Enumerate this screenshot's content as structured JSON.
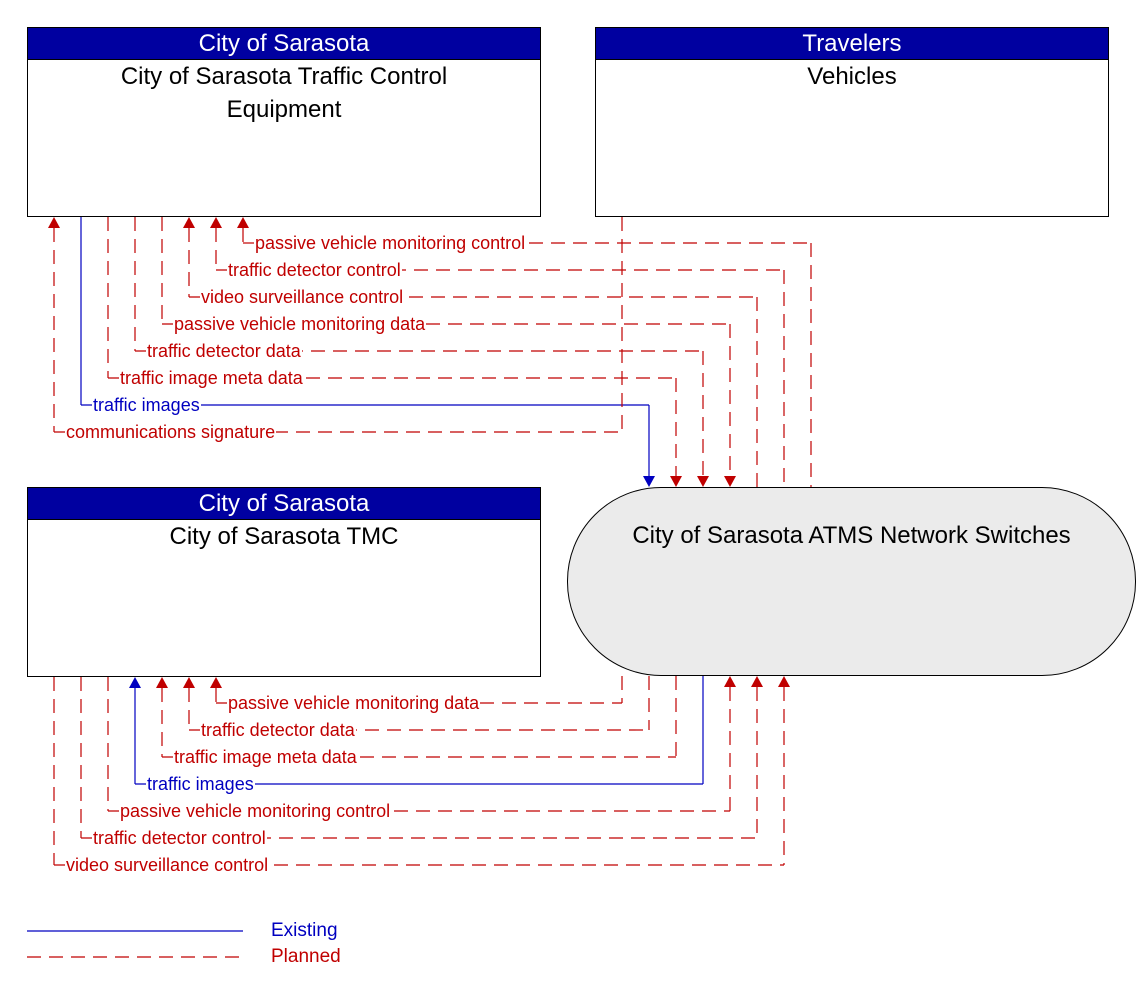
{
  "colors": {
    "existing": "#0000c0",
    "planned": "#c00000",
    "header_bg": "#0000a0",
    "oval_bg": "#ebebeb"
  },
  "elements": {
    "traffic_control": {
      "owner": "City of Sarasota",
      "name": "City of Sarasota Traffic Control Equipment"
    },
    "vehicles": {
      "owner": "Travelers",
      "name": "Vehicles"
    },
    "tmc": {
      "owner": "City of Sarasota",
      "name": "City of Sarasota TMC"
    },
    "network_switches": {
      "name": "City of Sarasota ATMS Network Switches"
    }
  },
  "flows_upper": [
    {
      "label": "passive vehicle monitoring control",
      "status": "planned",
      "direction": "to-traffic-control"
    },
    {
      "label": "traffic detector control",
      "status": "planned",
      "direction": "to-traffic-control"
    },
    {
      "label": "video surveillance control",
      "status": "planned",
      "direction": "to-traffic-control"
    },
    {
      "label": "passive vehicle monitoring data",
      "status": "planned",
      "direction": "to-network-switches"
    },
    {
      "label": "traffic detector data",
      "status": "planned",
      "direction": "to-network-switches"
    },
    {
      "label": "traffic image meta data",
      "status": "planned",
      "direction": "to-network-switches"
    },
    {
      "label": "traffic images",
      "status": "existing",
      "direction": "to-network-switches"
    },
    {
      "label": "communications signature",
      "status": "planned",
      "direction": "vehicles-to-traffic-control"
    }
  ],
  "flows_lower": [
    {
      "label": "passive vehicle monitoring data",
      "status": "planned",
      "direction": "to-tmc"
    },
    {
      "label": "traffic detector data",
      "status": "planned",
      "direction": "to-tmc"
    },
    {
      "label": "traffic image meta data",
      "status": "planned",
      "direction": "to-tmc"
    },
    {
      "label": "traffic images",
      "status": "existing",
      "direction": "to-tmc"
    },
    {
      "label": "passive vehicle monitoring control",
      "status": "planned",
      "direction": "to-network-switches"
    },
    {
      "label": "traffic detector control",
      "status": "planned",
      "direction": "to-network-switches"
    },
    {
      "label": "video surveillance control",
      "status": "planned",
      "direction": "to-network-switches"
    }
  ],
  "legend": {
    "existing": "Existing",
    "planned": "Planned"
  }
}
